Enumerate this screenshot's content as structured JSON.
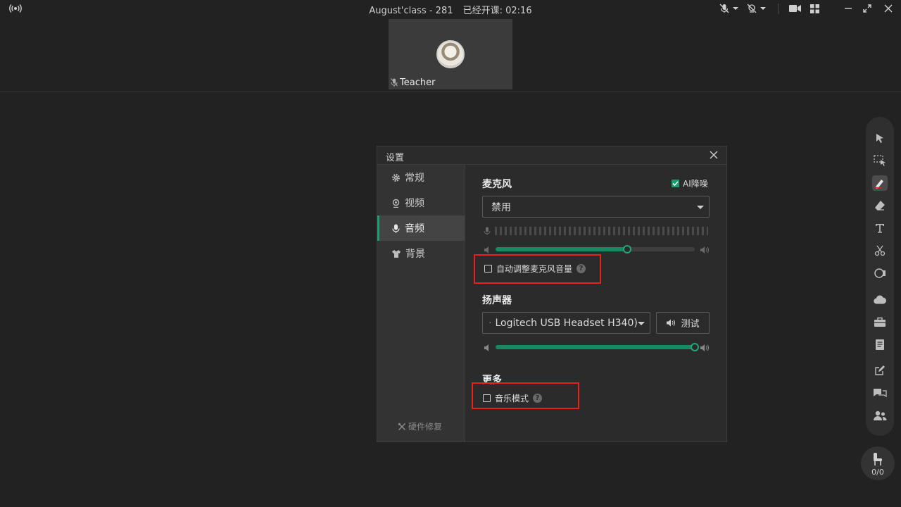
{
  "titlebar": {
    "class_name": "August'class - 281",
    "class_status": "已经开课: 02:16"
  },
  "video": {
    "participant_name": "Teacher"
  },
  "seat": {
    "count": "0/0"
  },
  "dialog": {
    "title": "设置",
    "nav": [
      {
        "label": "常规",
        "icon": "gear-icon"
      },
      {
        "label": "视频",
        "icon": "camera-icon"
      },
      {
        "label": "音频",
        "icon": "microphone-icon"
      },
      {
        "label": "背景",
        "icon": "shirt-icon"
      }
    ],
    "active_nav": "音频",
    "repair_label": "硬件修复",
    "microphone": {
      "title": "麦克风",
      "ai_denoise_label": "AI降噪",
      "ai_denoise_checked": true,
      "device": "禁用",
      "volume": 0.66,
      "auto_adjust_label": "自动调整麦克风音量",
      "auto_adjust_checked": false
    },
    "speaker": {
      "title": "扬声器",
      "device": "Logitech USB Headset H340)",
      "test_label": "测试",
      "volume": 1.0
    },
    "more": {
      "title": "更多",
      "music_mode_label": "音乐模式",
      "music_mode_checked": false
    }
  },
  "colors": {
    "accent": "#1a9e6e",
    "highlight": "#e8221b",
    "background": "#222222"
  }
}
